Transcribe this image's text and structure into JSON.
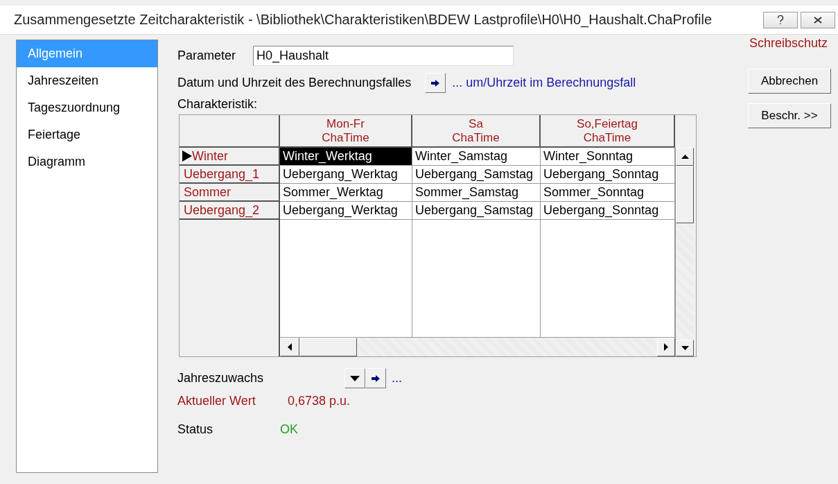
{
  "window": {
    "title": "Zusammengesetzte Zeitcharakteristik - \\Bibliothek\\Charakteristiken\\BDEW Lastprofile\\H0\\H0_Haushalt.ChaProfile"
  },
  "sidebar": {
    "items": [
      {
        "label": "Allgemein",
        "selected": true
      },
      {
        "label": "Jahreszeiten",
        "selected": false
      },
      {
        "label": "Tageszuordnung",
        "selected": false
      },
      {
        "label": "Feiertage",
        "selected": false
      },
      {
        "label": "Diagramm",
        "selected": false
      }
    ]
  },
  "parameter": {
    "label": "Parameter",
    "value": "H0_Haushalt"
  },
  "calculation_date": {
    "label": "Datum und Uhrzeit des Berechnungsfalles",
    "link": "... um/Uhrzeit im Berechnungsfall"
  },
  "grid": {
    "label": "Charakteristik:",
    "columns": [
      {
        "name": "Mon-Fr",
        "type": "ChaTime"
      },
      {
        "name": "Sa",
        "type": "ChaTime"
      },
      {
        "name": "So,Feiertag",
        "type": "ChaTime"
      }
    ],
    "rows": [
      {
        "header": "Winter",
        "current": true,
        "cells": [
          {
            "text": "Winter_Werktag",
            "selected": true
          },
          {
            "text": "Winter_Samstag",
            "selected": false
          },
          {
            "text": "Winter_Sonntag",
            "selected": false
          }
        ]
      },
      {
        "header": "Uebergang_1",
        "current": false,
        "cells": [
          {
            "text": "Uebergang_Werktag",
            "selected": false
          },
          {
            "text": "Uebergang_Samstag",
            "selected": false
          },
          {
            "text": "Uebergang_Sonntag",
            "selected": false
          }
        ]
      },
      {
        "header": "Sommer",
        "current": false,
        "cells": [
          {
            "text": "Sommer_Werktag",
            "selected": false
          },
          {
            "text": "Sommer_Samstag",
            "selected": false
          },
          {
            "text": "Sommer_Sonntag",
            "selected": false
          }
        ]
      },
      {
        "header": "Uebergang_2",
        "current": false,
        "cells": [
          {
            "text": "Uebergang_Werktag",
            "selected": false
          },
          {
            "text": "Uebergang_Samstag",
            "selected": false
          },
          {
            "text": "Uebergang_Sonntag",
            "selected": false
          }
        ]
      }
    ]
  },
  "annual_growth": {
    "label": "Jahreszuwachs",
    "link": "..."
  },
  "current_value": {
    "label": "Aktueller Wert",
    "value": "0,6738 p.u."
  },
  "status": {
    "label": "Status",
    "value": "OK"
  },
  "write_protection": "Schreibschutz",
  "buttons": [
    "Abbrechen",
    "Beschr. >>"
  ]
}
